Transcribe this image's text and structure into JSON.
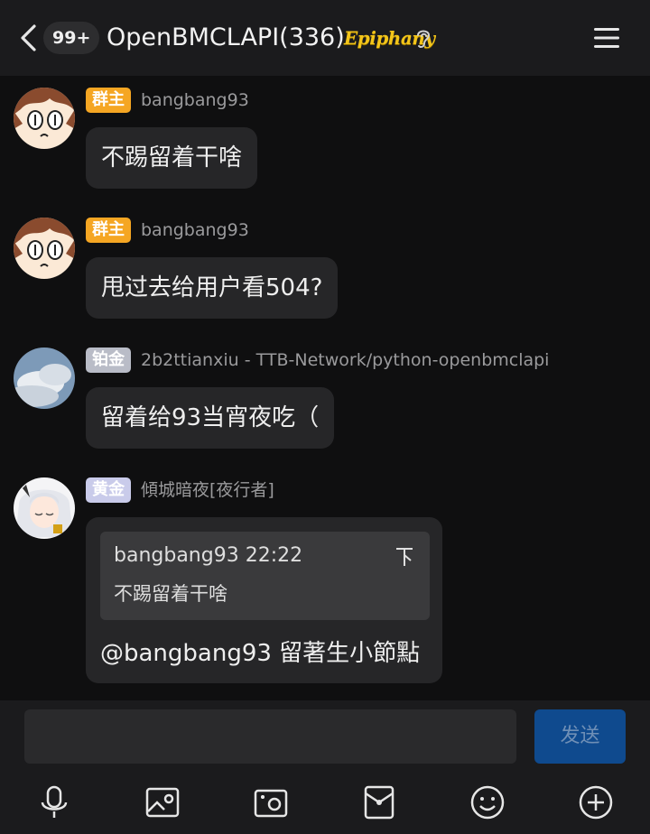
{
  "header": {
    "unread_badge": "99+",
    "title": "OpenBMCLAPI(336)",
    "title_badge": "Epiphany",
    "icons": [
      "back-icon",
      "ear-icon",
      "menu-icon"
    ]
  },
  "messages": [
    {
      "role": "群主",
      "sender": "bangbang93",
      "text": "不踢留着干啥"
    },
    {
      "role": "群主",
      "sender": "bangbang93",
      "text": "甩过去给用户看504?"
    },
    {
      "role": "铂金",
      "sender": "2b2ttianxiu - TTB-Network/python-openbmclapi",
      "text": "留着给93当宵夜吃（"
    },
    {
      "role": "黄金",
      "sender": "傾城暗夜[夜行者]",
      "quote": {
        "author_time": "bangbang93 22:22",
        "text": "不踢留着干啥"
      },
      "text": "@bangbang93 留著生小節點"
    }
  ],
  "input": {
    "placeholder": "",
    "send_label": "发送"
  },
  "toolbar": [
    "microphone-icon",
    "image-icon",
    "camera-icon",
    "red-packet-icon",
    "emoji-icon",
    "plus-icon"
  ],
  "colors": {
    "owner_badge": "#f5a623",
    "platinum_badge": "#b9bcc7",
    "gold_badge": "#c9cbea",
    "title_badge": "#f3c51a",
    "send_button": "#0f4a8e"
  }
}
